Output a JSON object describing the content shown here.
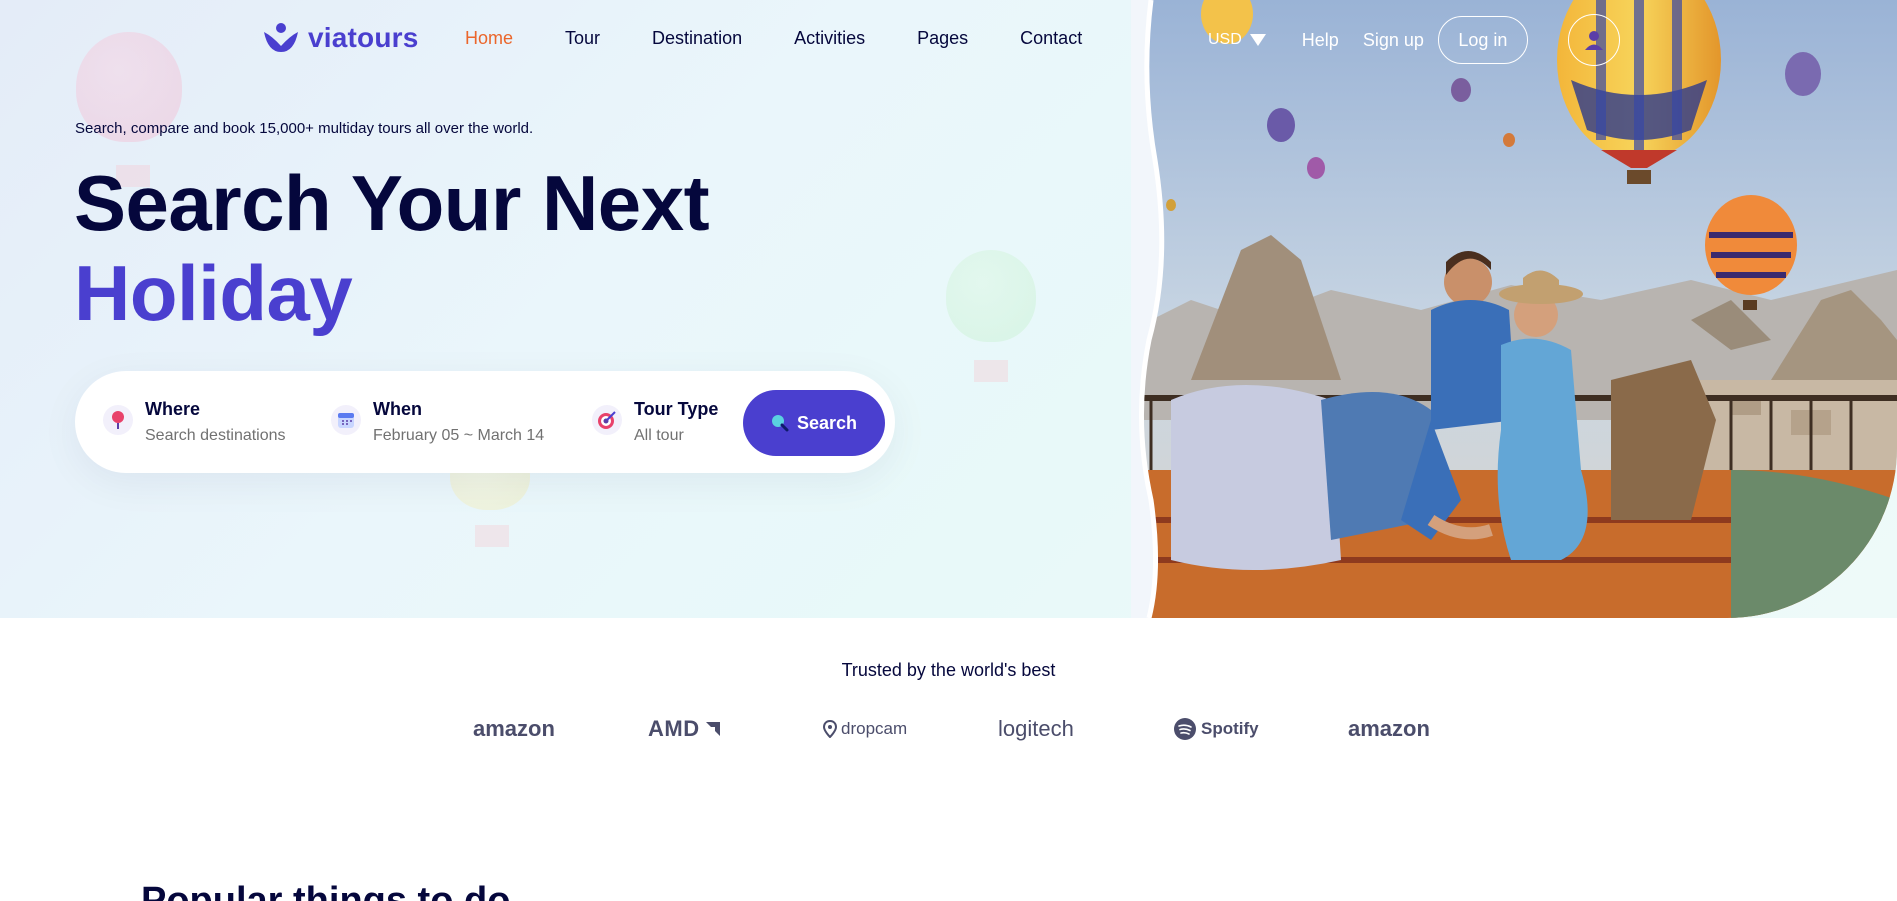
{
  "brand": {
    "name": "viatours",
    "accent": "#4a3fcf",
    "active_nav": "#eb662b"
  },
  "nav": {
    "items": [
      "Home",
      "Tour",
      "Destination",
      "Activities",
      "Pages",
      "Contact"
    ],
    "active": "Home"
  },
  "header_right": {
    "currency": "USD",
    "help": "Help",
    "signup": "Sign up",
    "login": "Log in",
    "avatar_icon": "user-icon"
  },
  "hero": {
    "tagline": "Search, compare and book 15,000+ multiday tours all over the world.",
    "title_line1": "Search Your Next",
    "title_line2": "Holiday"
  },
  "search": {
    "fields": [
      {
        "label": "Where",
        "value": "Search destinations",
        "icon": "map-pin-icon"
      },
      {
        "label": "When",
        "value": "February 05 ~ March 14",
        "icon": "calendar-icon"
      },
      {
        "label": "Tour Type",
        "value": "All tour",
        "icon": "target-icon"
      }
    ],
    "button_label": "Search",
    "button_icon": "search-icon"
  },
  "trusted": {
    "heading": "Trusted by the world's best",
    "brands": [
      "amazon",
      "AMD",
      "dropcam",
      "logitech",
      "Spotify",
      "amazon"
    ]
  },
  "next_section": {
    "heading": "Popular things to do"
  }
}
